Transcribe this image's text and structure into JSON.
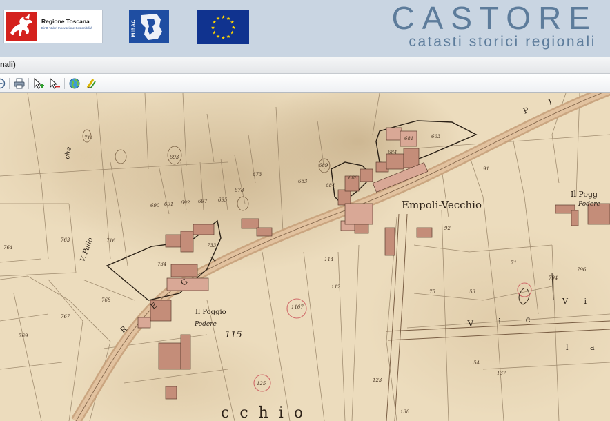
{
  "header": {
    "logos": [
      {
        "name": "regione-toscana-logo",
        "title": "Regione Toscana",
        "subtitle": "Diritti Valori Innovazione Sostenibilità"
      },
      {
        "name": "mibac-logo",
        "title": "MiBAC"
      },
      {
        "name": "european-union-flag"
      }
    ],
    "brand_title": "CASTORE",
    "brand_subtitle": "catasti storici regionali"
  },
  "window": {
    "title": "nali)"
  },
  "toolbar": {
    "tools": [
      {
        "name": "zoom-out-icon",
        "label": "Zoom out"
      },
      {
        "name": "print-icon",
        "label": "Print"
      },
      {
        "name": "add-selection-icon",
        "label": "Add to selection"
      },
      {
        "name": "remove-selection-icon",
        "label": "Remove from selection"
      },
      {
        "name": "globe-icon",
        "label": "Globe"
      },
      {
        "name": "measure-icon",
        "label": "Measure"
      }
    ]
  },
  "map": {
    "place_labels": {
      "empoli_vecchio": "Empoli-Vecchio",
      "il_poggio": "Il Pogg",
      "podere_top": "Podere",
      "il_poggio_2": "Il Poggio",
      "podere_bottom": "Podere",
      "number_115": "115",
      "checchio": "c c h i o",
      "strada_road_letters": "R E G I",
      "strada_road_letters_2": "P I",
      "vicinale": "V i c",
      "strada_right": "V i",
      "strada_right_2": "l a",
      "vpallo": "V. Pallo",
      "che": "che"
    },
    "parcel_numbers": [
      "693",
      "690",
      "691",
      "692",
      "697",
      "695",
      "683",
      "689",
      "684",
      "686",
      "663",
      "684",
      "681",
      "678",
      "673",
      "764",
      "763",
      "711",
      "716",
      "768",
      "767",
      "769",
      "733",
      "734",
      "794",
      "796",
      "1167",
      "125",
      "114",
      "112",
      "92",
      "91",
      "71",
      "75",
      "53",
      "54",
      "123",
      "137",
      "138"
    ]
  },
  "colors": {
    "banner_bg": "#c9d5e2",
    "brand_text": "#5d7c9b",
    "map_paper": "#ead9b9",
    "building_pink": "#c98f7c",
    "road": "#d4b08d"
  }
}
